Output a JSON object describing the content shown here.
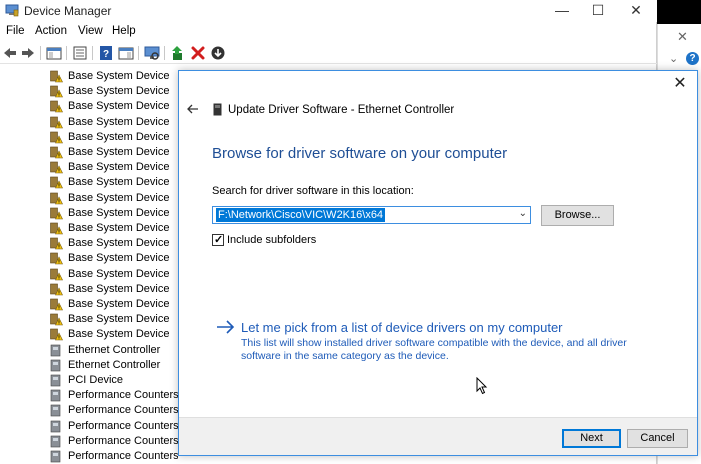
{
  "window": {
    "title": "Device Manager",
    "minimize_glyph": "—",
    "maximize_glyph": "☐",
    "close_glyph": "✕"
  },
  "menu": [
    "File",
    "Action",
    "View",
    "Help"
  ],
  "toolbar_icons": [
    "back-arrow-icon",
    "forward-arrow-icon",
    "show-hide-tree-icon",
    "properties-icon",
    "help-icon",
    "action-pane-icon",
    "scan-hardware-icon",
    "update-driver-icon",
    "uninstall-icon",
    "disable-device-icon"
  ],
  "tree": {
    "items": [
      "Base System Device",
      "Base System Device",
      "Base System Device",
      "Base System Device",
      "Base System Device",
      "Base System Device",
      "Base System Device",
      "Base System Device",
      "Base System Device",
      "Base System Device",
      "Base System Device",
      "Base System Device",
      "Base System Device",
      "Base System Device",
      "Base System Device",
      "Base System Device",
      "Base System Device",
      "Base System Device",
      "Ethernet Controller",
      "Ethernet Controller",
      "PCI Device",
      "Performance Counters",
      "Performance Counters",
      "Performance Counters",
      "Performance Counters",
      "Performance Counters"
    ]
  },
  "background_window": {
    "close_glyph": "✕",
    "chevron_glyph": "⌄",
    "help_glyph": "?"
  },
  "dialog": {
    "close_glyph": "✕",
    "title": "Update Driver Software - Ethernet Controller",
    "heading": "Browse for driver software on your computer",
    "location_label": "Search for driver software in this location:",
    "path_value": "F:\\Network\\Cisco\\VIC\\W2K16\\x64",
    "dropdown_glyph": "⌄",
    "browse_label": "Browse...",
    "include_subfolders_label": "Include subfolders",
    "include_subfolders_checked": true,
    "check_glyph": "✓",
    "pick_link": "Let me pick from a list of device drivers on my computer",
    "pick_desc": "This list will show installed driver software compatible with the device, and all driver software in the same category as the device.",
    "next_label": "Next",
    "cancel_label": "Cancel"
  },
  "colors": {
    "accent": "#0078d7",
    "heading_blue": "#1e4e95",
    "link_blue": "#1e5bb8",
    "dialog_border": "#3d8ee0"
  }
}
